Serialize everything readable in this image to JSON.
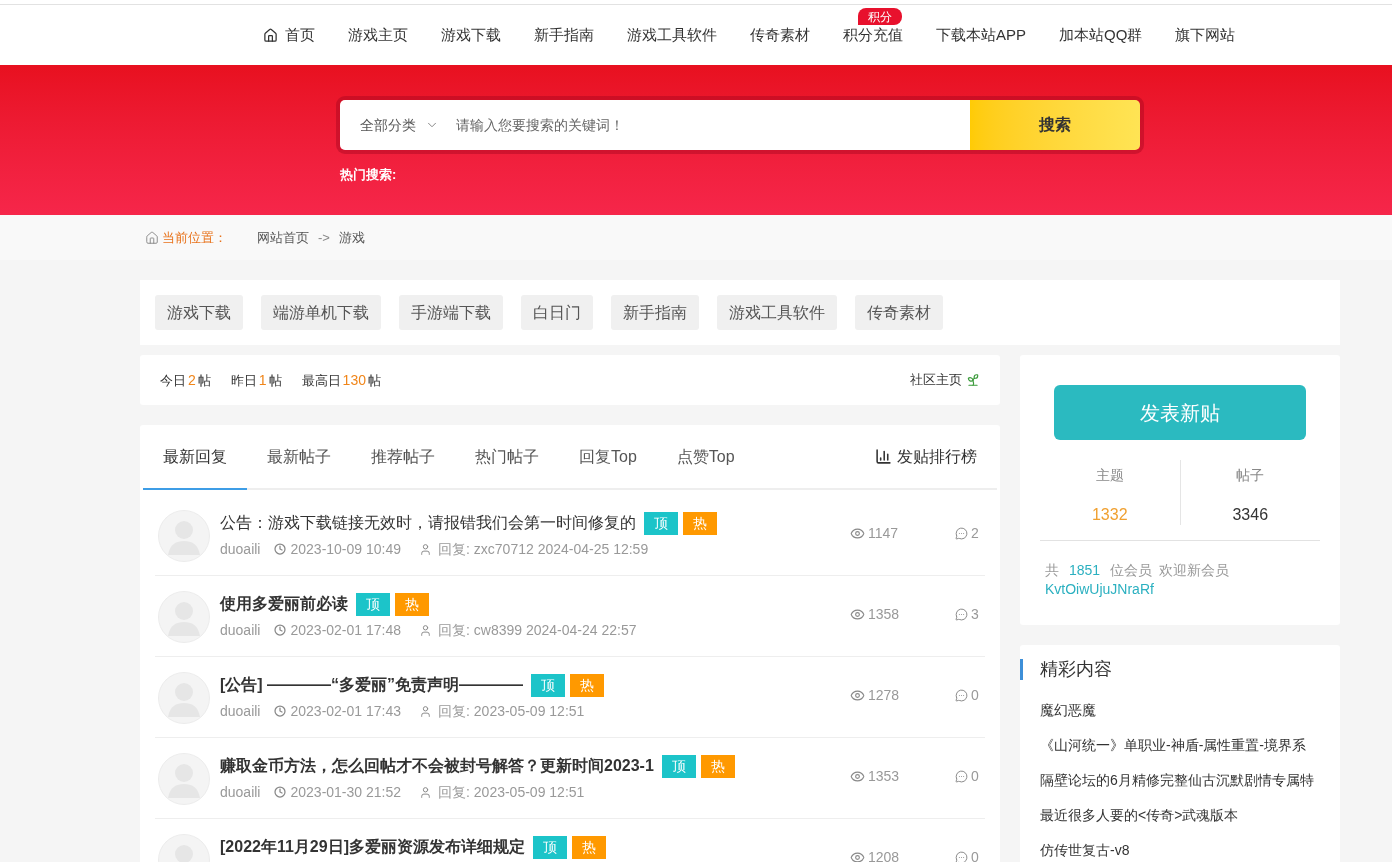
{
  "nav": {
    "items": [
      {
        "label": "首页",
        "kind": "home"
      },
      {
        "label": "游戏主页",
        "kind": "link"
      },
      {
        "label": "游戏下载",
        "kind": "link"
      },
      {
        "label": "新手指南",
        "kind": "link"
      },
      {
        "label": "游戏工具软件",
        "kind": "link"
      },
      {
        "label": "传奇素材",
        "kind": "link"
      },
      {
        "label": "积分充值",
        "kind": "link",
        "badge": "积分"
      },
      {
        "label": "下载本站APP",
        "kind": "link"
      },
      {
        "label": "加本站QQ群",
        "kind": "link"
      },
      {
        "label": "旗下网站",
        "kind": "link"
      }
    ]
  },
  "search": {
    "category": "全部分类",
    "placeholder": "请输入您要搜索的关键词！",
    "button": "搜索"
  },
  "hot_search": {
    "label": "热门搜索:"
  },
  "breadcrumb": {
    "label": "当前位置：",
    "items": [
      "网站首页",
      "游戏"
    ],
    "separator": "->"
  },
  "categories": [
    "游戏下载",
    "端游单机下载",
    "手游端下载",
    "白日门",
    "新手指南",
    "游戏工具软件",
    "传奇素材"
  ],
  "stats": {
    "items": [
      {
        "label": "今日",
        "value": "2",
        "unit": "帖"
      },
      {
        "label": "昨日",
        "value": "1",
        "unit": "帖"
      },
      {
        "label": "最高日",
        "value": "130",
        "unit": "帖"
      }
    ],
    "link": "社区主页"
  },
  "tabs": {
    "items": [
      {
        "label": "最新回复",
        "selected": true
      },
      {
        "label": "最新帖子",
        "selected": false
      },
      {
        "label": "推荐帖子",
        "selected": false
      },
      {
        "label": "热门帖子",
        "selected": false
      },
      {
        "label": "回复Top",
        "selected": false
      },
      {
        "label": "点赞Top",
        "selected": false
      }
    ],
    "ranking": "发贴排行榜"
  },
  "posts": [
    {
      "title": "公告：游戏下载链接无效时，请报错我们会第一时间修复的",
      "bold": false,
      "badges": [
        {
          "text": "顶",
          "kind": "top"
        },
        {
          "text": "热",
          "kind": "hot"
        }
      ],
      "author": "duoaili",
      "time": "2023-10-09 10:49",
      "reply": "回复: zxc70712 2024-04-25 12:59",
      "views": "1147",
      "replies": "2"
    },
    {
      "title": "使用多爱丽前必读",
      "bold": true,
      "badges": [
        {
          "text": "顶",
          "kind": "top"
        },
        {
          "text": "热",
          "kind": "hot"
        }
      ],
      "author": "duoaili",
      "time": "2023-02-01 17:48",
      "reply": "回复: cw8399 2024-04-24 22:57",
      "views": "1358",
      "replies": "3"
    },
    {
      "title": "[公告] ————“多爱丽”免责声明————",
      "bold": true,
      "badges": [
        {
          "text": "顶",
          "kind": "top"
        },
        {
          "text": "热",
          "kind": "hot"
        }
      ],
      "author": "duoaili",
      "time": "2023-02-01 17:43",
      "reply": "回复: 2023-05-09 12:51",
      "views": "1278",
      "replies": "0"
    },
    {
      "title": "赚取金币方法，怎么回帖才不会被封号解答？更新时间2023-1",
      "bold": true,
      "badges": [
        {
          "text": "顶",
          "kind": "top"
        },
        {
          "text": "热",
          "kind": "hot"
        }
      ],
      "author": "duoaili",
      "time": "2023-01-30 21:52",
      "reply": "回复: 2023-05-09 12:51",
      "views": "1353",
      "replies": "0"
    },
    {
      "title": "[2022年11月29日]多爱丽资源发布详细规定",
      "bold": true,
      "badges": [
        {
          "text": "顶",
          "kind": "top"
        },
        {
          "text": "热",
          "kind": "hot"
        }
      ],
      "views": "1208",
      "replies": "0"
    }
  ],
  "sidebar": {
    "post_button": "发表新贴",
    "counts": [
      {
        "label": "主题",
        "value": "1332",
        "color": "#f0a030"
      },
      {
        "label": "帖子",
        "value": "3346",
        "color": "#333333"
      }
    ],
    "members": {
      "prefix": "共",
      "count": "1851",
      "suffix": "位会员",
      "welcome": "欢迎新会员",
      "newest": "KvtOiwUjuJNraRf"
    },
    "featured": {
      "title": "精彩内容",
      "items": [
        "魔幻恶魔",
        "《山河统一》单职业-神盾-属性重置-境界系",
        "隔壁论坛的6月精修完整仙古沉默剧情专属特",
        "最近很多人要的<传奇>武魂版本",
        "仿传世复古-v8"
      ]
    }
  }
}
